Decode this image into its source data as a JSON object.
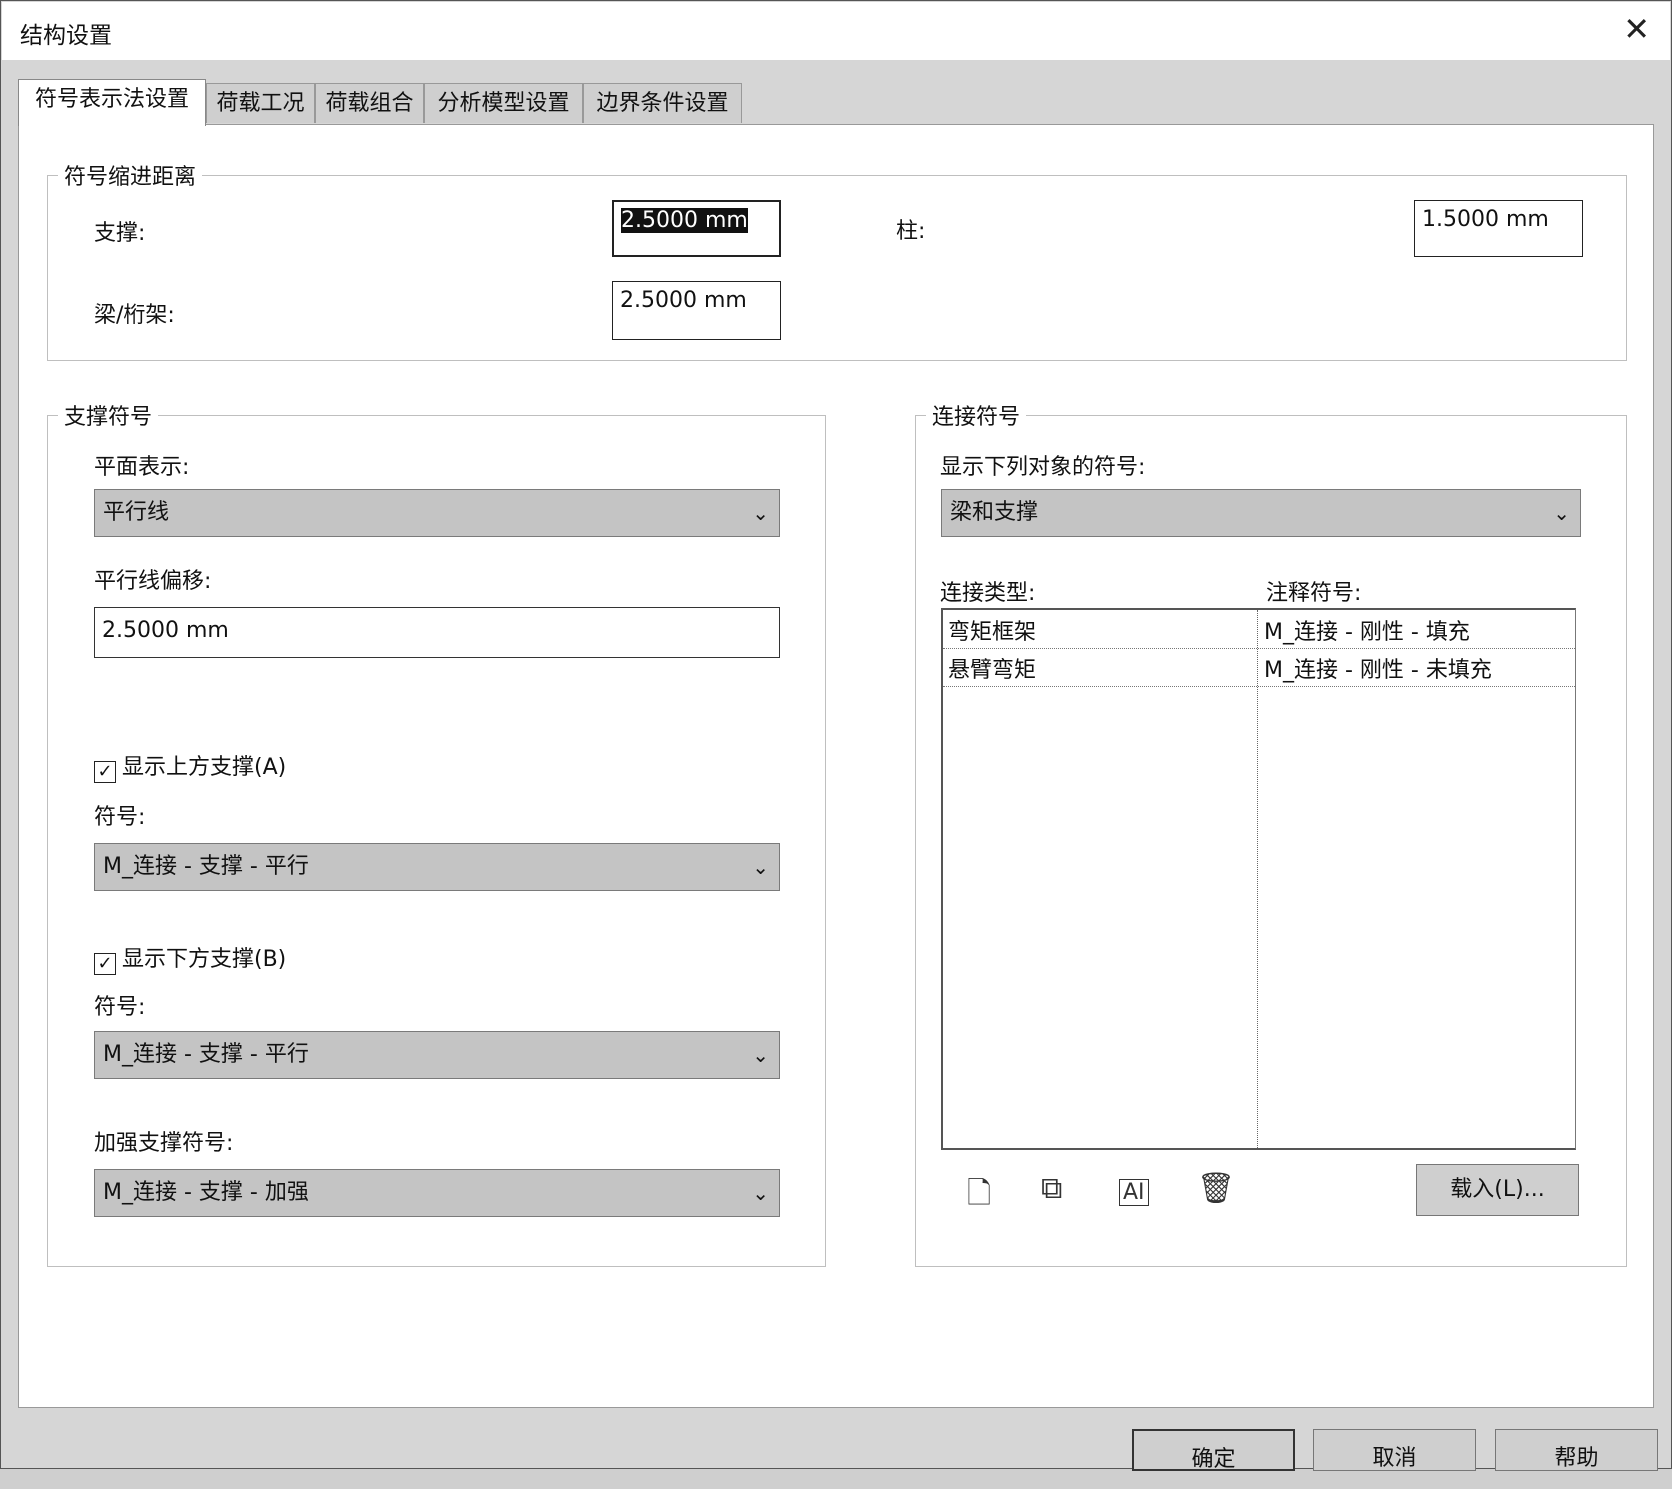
{
  "window": {
    "title": "结构设置",
    "close_icon": "close-icon"
  },
  "tabs": [
    {
      "label": "符号表示法设置",
      "active": true
    },
    {
      "label": "荷载工况"
    },
    {
      "label": "荷载组合"
    },
    {
      "label": "分析模型设置"
    },
    {
      "label": "边界条件设置"
    }
  ],
  "indent": {
    "legend": "符号缩进距离",
    "brace_label": "支撑:",
    "brace_value": "2.5000 mm",
    "column_label": "柱:",
    "column_value": "1.5000 mm",
    "beam_label": "梁/桁架:",
    "beam_value": "2.5000 mm"
  },
  "brace_symbols": {
    "legend": "支撑符号",
    "plan_label": "平面表示:",
    "plan_value": "平行线",
    "offset_label": "平行线偏移:",
    "offset_value": "2.5000 mm",
    "show_above": {
      "label": "显示上方支撑(A)",
      "checked": true,
      "mark": "✓"
    },
    "symbol_label_1": "符号:",
    "symbol_value_1": "M_连接 - 支撑 - 平行",
    "show_below": {
      "label": "显示下方支撑(B)",
      "checked": true,
      "mark": "✓"
    },
    "symbol_label_2": "符号:",
    "symbol_value_2": "M_连接 - 支撑 - 平行",
    "kicker_label": "加强支撑符号:",
    "kicker_value": "M_连接 - 支撑 - 加强"
  },
  "connection_symbols": {
    "legend": "连接符号",
    "show_label": "显示下列对象的符号:",
    "show_value": "梁和支撑",
    "col1_header": "连接类型:",
    "col2_header": "注释符号:",
    "rows": [
      {
        "type": "弯矩框架",
        "symbol": "M_连接 - 刚性 - 填充"
      },
      {
        "type": "悬臂弯矩",
        "symbol": "M_连接 - 刚性 - 未填充"
      }
    ],
    "icons": [
      "new-icon",
      "duplicate-icon",
      "rename-icon",
      "delete-icon"
    ],
    "load_button": "载入(L)..."
  },
  "footer": {
    "ok": "确定",
    "cancel": "取消",
    "help": "帮助"
  },
  "dropdown_glyph": "⌄"
}
